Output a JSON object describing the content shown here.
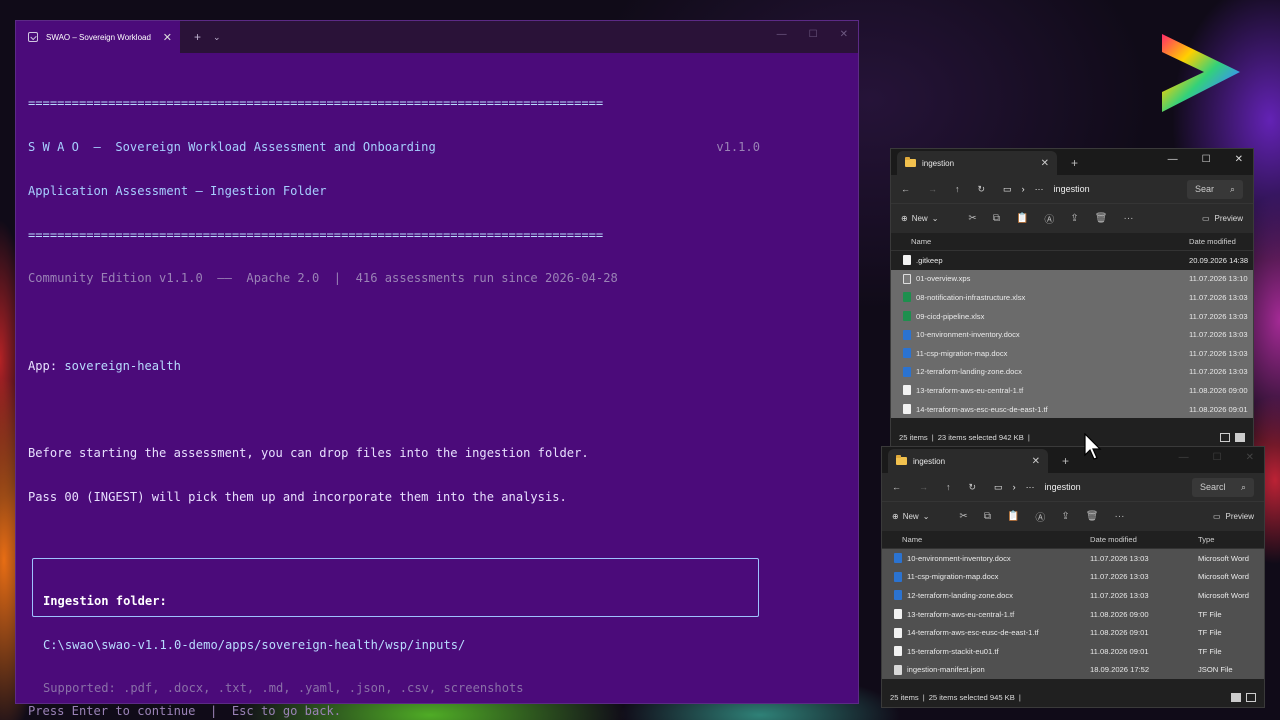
{
  "terminal": {
    "tab_title": "SWAO – Sovereign Workload",
    "rule": "===============================================================================",
    "header_line1": "S W A O  –  Sovereign Workload Assessment and Onboarding",
    "version": "v1.1.0",
    "header_line2": "Application Assessment – Ingestion Folder",
    "edition_line": "Community Edition v1.1.0  ––  Apache 2.0  |  416 assessments run since 2026-04-28",
    "app_label": "App: ",
    "app_name": "sovereign-health",
    "intro_line1": "Before starting the assessment, you can drop files into the ingestion folder.",
    "intro_line2": "Pass 00 (INGEST) will pick them up and incorporate them into the analysis.",
    "ingest_label": "Ingestion folder:",
    "ingest_path": "C:\\swao\\swao-v1.1.0-demo/apps/sovereign-health/wsp/inputs/",
    "supported": "Supported: .pdf, .docx, .txt, .md, .yaml, .json, .csv, screenshots",
    "hint": "Press Enter to continue  |  Esc to go back."
  },
  "explorer_top": {
    "tab_title": "ingestion",
    "path": "ingestion",
    "search": "Sear",
    "new_label": "New",
    "preview_label": "Preview",
    "col_name": "Name",
    "col_date": "Date modified",
    "rows": [
      {
        "name": ".gitkeep",
        "date": "20.09.2026 14:38",
        "icon": "plain",
        "selected": false
      },
      {
        "name": "01-overview.xps",
        "date": "11.07.2026 13:10",
        "icon": "xps",
        "selected": true
      },
      {
        "name": "08-notification-infrastructure.xlsx",
        "date": "11.07.2026 13:03",
        "icon": "excel",
        "selected": true
      },
      {
        "name": "09-cicd-pipeline.xlsx",
        "date": "11.07.2026 13:03",
        "icon": "excel",
        "selected": true
      },
      {
        "name": "10-environment-inventory.docx",
        "date": "11.07.2026 13:03",
        "icon": "word",
        "selected": true
      },
      {
        "name": "11-csp-migration-map.docx",
        "date": "11.07.2026 13:03",
        "icon": "word",
        "selected": true
      },
      {
        "name": "12-terraform-landing-zone.docx",
        "date": "11.07.2026 13:03",
        "icon": "word",
        "selected": true
      },
      {
        "name": "13-terraform-aws-eu-central-1.tf",
        "date": "11.08.2026 09:00",
        "icon": "plain",
        "selected": true
      },
      {
        "name": "14-terraform-aws-esc-eusc-de-east-1.tf",
        "date": "11.08.2026 09:01",
        "icon": "plain",
        "selected": true
      }
    ],
    "status_items": "25 items",
    "status_selected": "23 items selected  942 KB"
  },
  "explorer_bottom": {
    "tab_title": "ingestion",
    "path": "ingestion",
    "search": "Searcl",
    "new_label": "New",
    "preview_label": "Preview",
    "col_name": "Name",
    "col_date": "Date modified",
    "col_type": "Type",
    "rows": [
      {
        "name": "10-environment-inventory.docx",
        "date": "11.07.2026 13:03",
        "type": "Microsoft Word",
        "icon": "word"
      },
      {
        "name": "11-csp-migration-map.docx",
        "date": "11.07.2026 13:03",
        "type": "Microsoft Word",
        "icon": "word"
      },
      {
        "name": "12-terraform-landing-zone.docx",
        "date": "11.07.2026 13:03",
        "type": "Microsoft Word",
        "icon": "word"
      },
      {
        "name": "13-terraform-aws-eu-central-1.tf",
        "date": "11.08.2026 09:00",
        "type": "TF File",
        "icon": "plain"
      },
      {
        "name": "14-terraform-aws-esc-eusc-de-east-1.tf",
        "date": "11.08.2026 09:01",
        "type": "TF File",
        "icon": "plain"
      },
      {
        "name": "15-terraform-stackit-eu01.tf",
        "date": "11.08.2026 09:01",
        "type": "TF File",
        "icon": "plain"
      },
      {
        "name": "ingestion-manifest.json",
        "date": "18.09.2026 17:52",
        "type": "JSON File",
        "icon": "json"
      }
    ],
    "status_items": "25 items",
    "status_selected": "25 items selected  945 KB"
  },
  "colors": {
    "terminal_bg": "#4b0b7a",
    "accent_blue": "#b9dcff",
    "explorer_bg": "#202020",
    "selection": "#6b6b6b"
  }
}
